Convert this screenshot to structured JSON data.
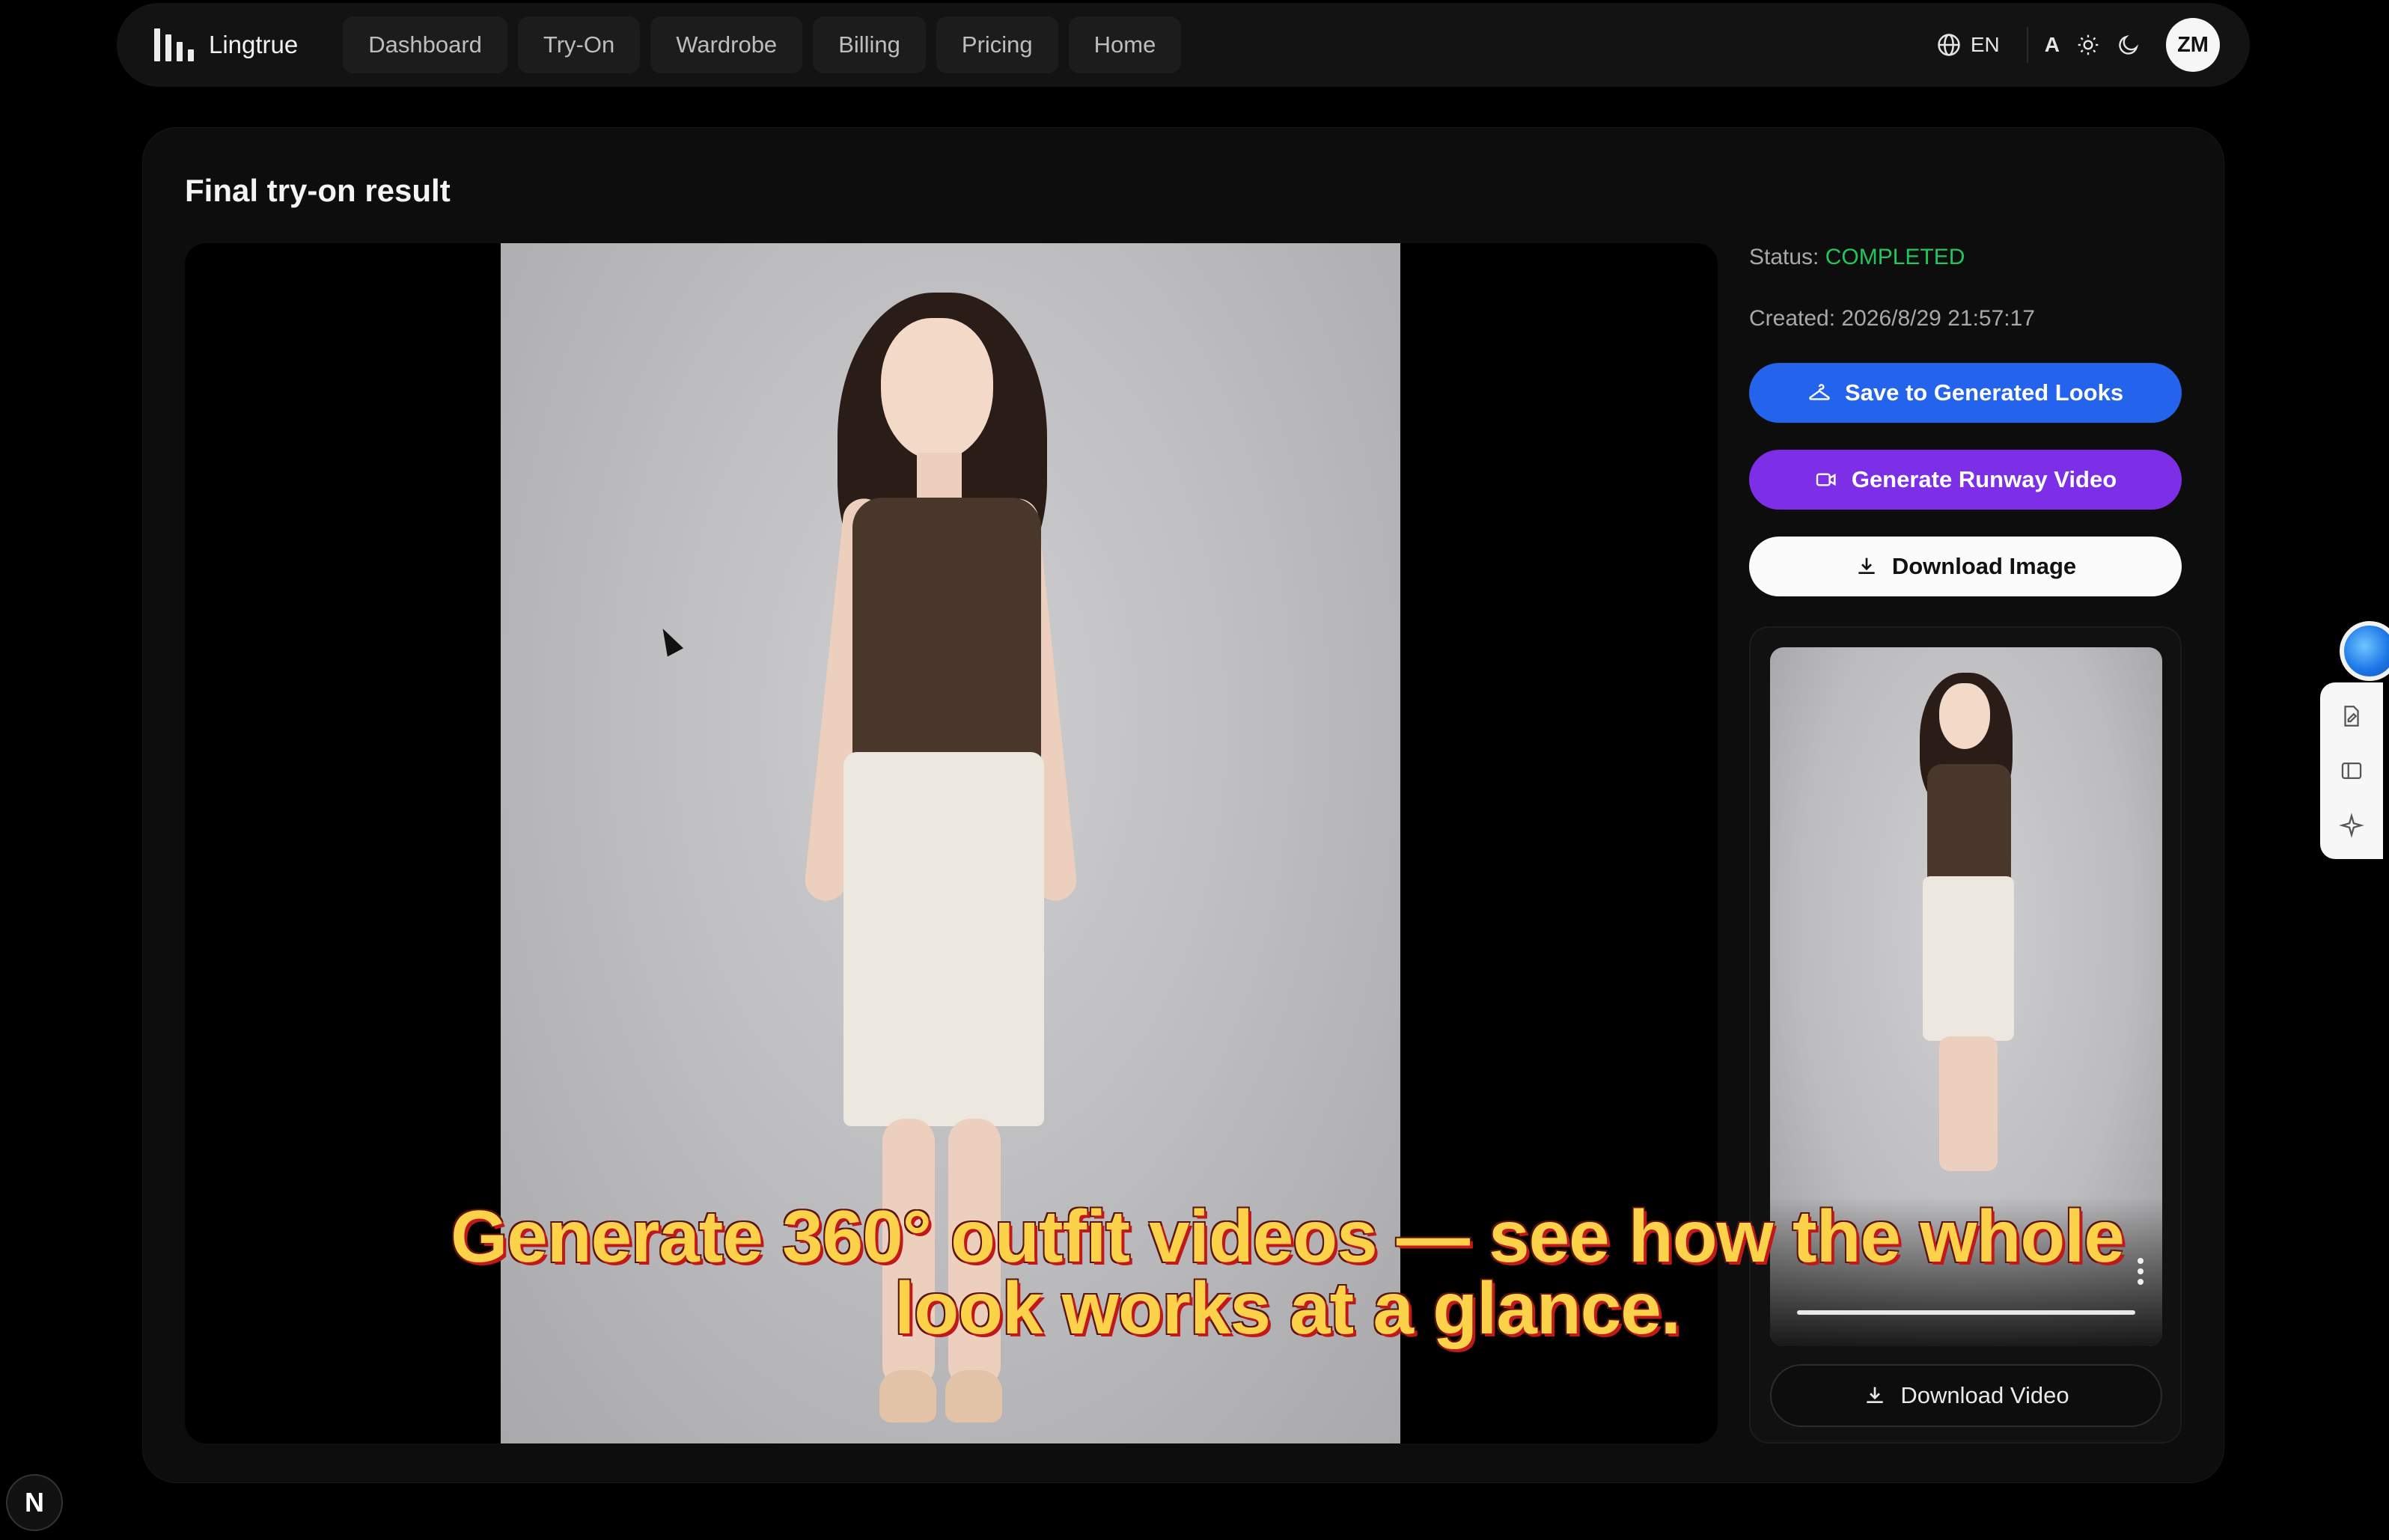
{
  "app": {
    "brand": "Lingtrue"
  },
  "nav": {
    "links": [
      {
        "label": "Dashboard"
      },
      {
        "label": "Try-On"
      },
      {
        "label": "Wardrobe"
      },
      {
        "label": "Billing"
      },
      {
        "label": "Pricing"
      },
      {
        "label": "Home"
      }
    ],
    "language": "EN",
    "font_size_toggle": "A",
    "avatar_initials": "ZM"
  },
  "result": {
    "title": "Final try-on result",
    "status_label": "Status:",
    "status_value": "COMPLETED",
    "created": "Created: 2026/8/29 21:57:17",
    "save_label": "Save to Generated Looks",
    "runway_label": "Generate Runway Video",
    "download_image_label": "Download Image",
    "download_video_label": "Download Video"
  },
  "caption": {
    "line1": "Generate 360° outfit videos — see how the whole",
    "line2": "look works at a glance."
  },
  "badge": {
    "letter": "N"
  },
  "colors": {
    "status_completed": "#22c55e",
    "save_button": "#2463eb",
    "runway_button": "#7c2fe6",
    "caption_text": "#fcd24a"
  },
  "icons": {
    "brand": "bars-logo-icon",
    "language": "globe-icon",
    "light_mode": "sun-icon",
    "dark_mode": "moon-icon",
    "save": "hanger-icon",
    "runway": "video-camera-icon",
    "download": "download-icon",
    "video_menu": "more-vertical-icon"
  }
}
